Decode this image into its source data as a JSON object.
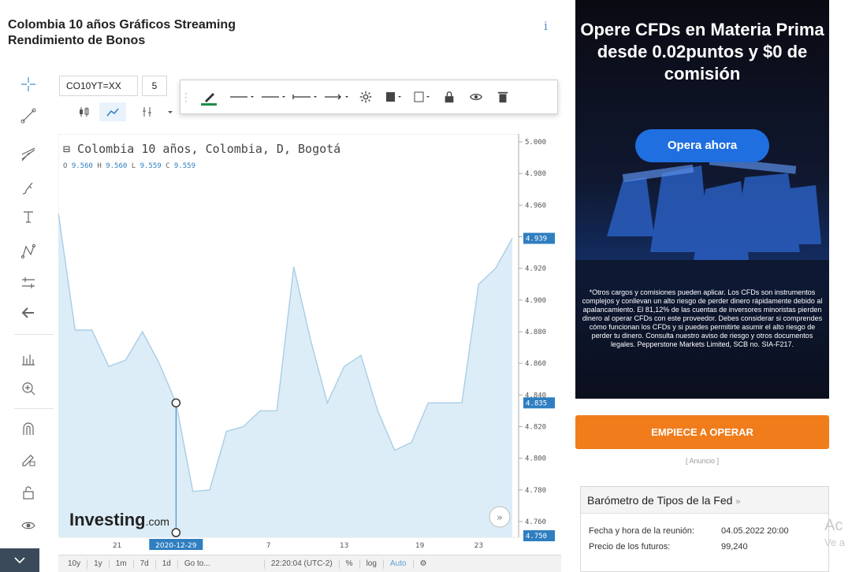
{
  "page": {
    "title_line1": "Colombia 10 años Gráficos Streaming",
    "title_line2": "Rendimiento de Bonos",
    "info_icon": "i"
  },
  "toolbar": {
    "symbol": "CO10YT=XX",
    "interval": "5"
  },
  "chart": {
    "header": "⊟ Colombia 10 años, Colombia, D, Bogotá",
    "ohlc": {
      "o_label": "O",
      "o": "9.560",
      "h_label": "H",
      "h": "9.560",
      "l_label": "L",
      "l": "9.559",
      "c_label": "C",
      "c": "9.559"
    },
    "logo_word": "Investing",
    "logo_suffix": ".com",
    "current_price_label": "4.939",
    "crosshair_price_label": "4.835",
    "bottom_price_label": "4.750",
    "partial_tick": "4.840",
    "crosshair_date_label": "2020-12-29"
  },
  "chart_data": {
    "type": "area",
    "x_ticks": [
      "21",
      "2020-12-29",
      "7",
      "13",
      "19",
      "23"
    ],
    "y_ticks": [
      "5.000",
      "4.980",
      "4.960",
      "4.940",
      "4.920",
      "4.900",
      "4.880",
      "4.860",
      "4.840",
      "4.820",
      "4.800",
      "4.780",
      "4.760"
    ],
    "y_tick_values": [
      5.0,
      4.98,
      4.96,
      4.94,
      4.92,
      4.9,
      4.88,
      4.86,
      4.84,
      4.82,
      4.8,
      4.78,
      4.76
    ],
    "ylim": [
      4.75,
      5.005
    ],
    "values": [
      4.955,
      4.881,
      4.881,
      4.858,
      4.862,
      4.88,
      4.86,
      4.835,
      4.779,
      4.78,
      4.817,
      4.82,
      4.83,
      4.83,
      4.921,
      4.875,
      4.835,
      4.858,
      4.865,
      4.83,
      4.805,
      4.81,
      4.835,
      4.835,
      4.835,
      4.91,
      4.92,
      4.939
    ],
    "crosshair_index": 7,
    "fill_color": "#dcedf7",
    "line_color": "#a9cde6"
  },
  "bottom_bar": {
    "items": [
      "10y",
      "1y",
      "1m",
      "7d",
      "1d",
      "Go to...",
      "22:20:04 (UTC-2)",
      "%",
      "log",
      "Auto"
    ]
  },
  "ad": {
    "headline": "Opere CFDs en Materia Prima desde 0.02puntos y $0 de comisión",
    "cta": "Opera ahora",
    "disclaimer": "*Otros cargos y comisiones pueden aplicar. Los CFDs son instrumentos complejos y conllevan un alto riesgo de perder dinero rápidamente debido al apalancamiento. El 81,12% de las cuentas de inversores minoristas pierden dinero al operar CFDs con este proveedor. Debes considerar si comprendes cómo funcionan los CFDs y si puedes permitirte asumir el alto riesgo de perder tu dinero. Consulta nuestro aviso de riesgo y otros documentos legales. Pepperstone Markets Limited, SCB no. SIA-F217.",
    "start_button": "EMPIECE A OPERAR",
    "label": "[ Anuncio ]"
  },
  "fed": {
    "title": "Barómetro de Tipos de la Fed",
    "title_arrow": "»",
    "rows": [
      {
        "label": "Fecha y hora de la reunión:",
        "value": "04.05.2022 20:00"
      },
      {
        "label": "Precio de los futuros:",
        "value": "99,240"
      }
    ]
  },
  "watermark": {
    "line1": "Ac",
    "line2": "Ve a"
  },
  "colors": {
    "accent": "#2f7ec1",
    "orange": "#f07c1c",
    "ad_blue": "#1f6fe0"
  }
}
